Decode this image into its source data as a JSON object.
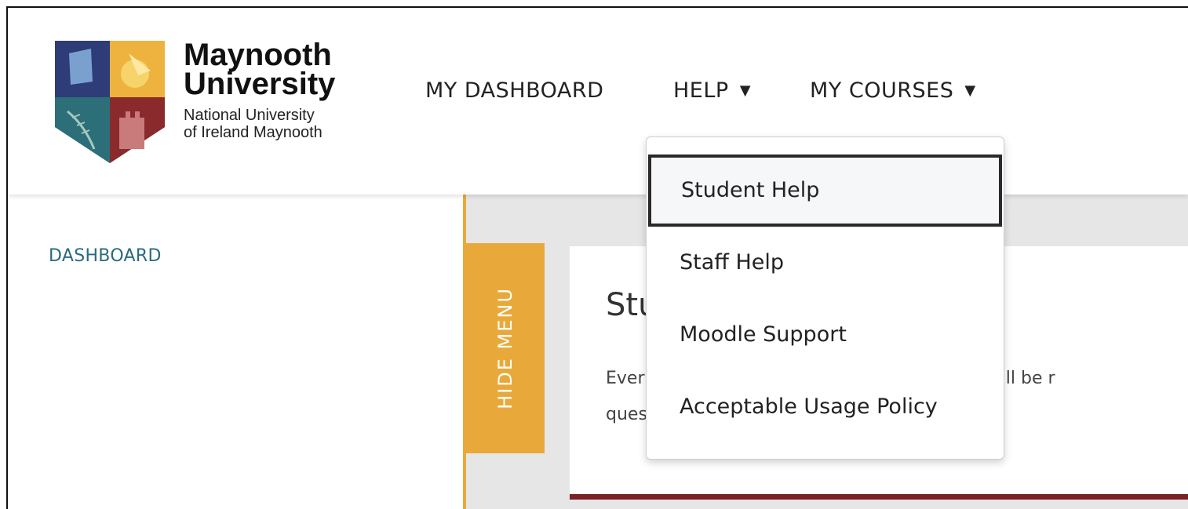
{
  "brand": {
    "name_line1": "Maynooth",
    "name_line2": "University",
    "sub_line1": "National University",
    "sub_line2": "of Ireland Maynooth"
  },
  "nav": {
    "dashboard": "MY DASHBOARD",
    "help": "HELP",
    "courses": "MY COURSES"
  },
  "help_menu": {
    "items": [
      "Student Help",
      "Staff Help",
      "Moodle Support",
      "Acceptable Usage Policy"
    ],
    "highlighted": "Student Help"
  },
  "sidebar": {
    "title": "DASHBOARD"
  },
  "hide_menu": {
    "label": "HIDE MENU"
  },
  "card": {
    "title": "Stu                              nitin Drop",
    "line1": "Ever                                              e Support will be r",
    "line2": "ques"
  },
  "colors": {
    "accent_yellow": "#e9a93a",
    "teal_text": "#2a6a7e",
    "card_border": "#7a2326"
  }
}
